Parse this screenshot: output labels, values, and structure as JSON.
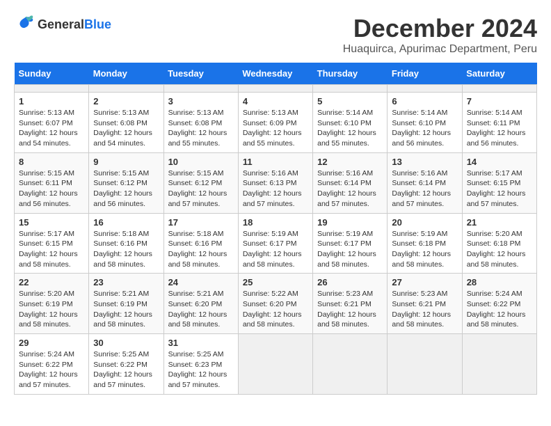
{
  "header": {
    "logo_general": "General",
    "logo_blue": "Blue",
    "title": "December 2024",
    "subtitle": "Huaquirca, Apurimac Department, Peru"
  },
  "calendar": {
    "days_of_week": [
      "Sunday",
      "Monday",
      "Tuesday",
      "Wednesday",
      "Thursday",
      "Friday",
      "Saturday"
    ],
    "weeks": [
      [
        {
          "day": "",
          "info": ""
        },
        {
          "day": "",
          "info": ""
        },
        {
          "day": "",
          "info": ""
        },
        {
          "day": "",
          "info": ""
        },
        {
          "day": "",
          "info": ""
        },
        {
          "day": "",
          "info": ""
        },
        {
          "day": "",
          "info": ""
        }
      ],
      [
        {
          "day": "1",
          "info": "Sunrise: 5:13 AM\nSunset: 6:07 PM\nDaylight: 12 hours\nand 54 minutes."
        },
        {
          "day": "2",
          "info": "Sunrise: 5:13 AM\nSunset: 6:08 PM\nDaylight: 12 hours\nand 54 minutes."
        },
        {
          "day": "3",
          "info": "Sunrise: 5:13 AM\nSunset: 6:08 PM\nDaylight: 12 hours\nand 55 minutes."
        },
        {
          "day": "4",
          "info": "Sunrise: 5:13 AM\nSunset: 6:09 PM\nDaylight: 12 hours\nand 55 minutes."
        },
        {
          "day": "5",
          "info": "Sunrise: 5:14 AM\nSunset: 6:10 PM\nDaylight: 12 hours\nand 55 minutes."
        },
        {
          "day": "6",
          "info": "Sunrise: 5:14 AM\nSunset: 6:10 PM\nDaylight: 12 hours\nand 56 minutes."
        },
        {
          "day": "7",
          "info": "Sunrise: 5:14 AM\nSunset: 6:11 PM\nDaylight: 12 hours\nand 56 minutes."
        }
      ],
      [
        {
          "day": "8",
          "info": "Sunrise: 5:15 AM\nSunset: 6:11 PM\nDaylight: 12 hours\nand 56 minutes."
        },
        {
          "day": "9",
          "info": "Sunrise: 5:15 AM\nSunset: 6:12 PM\nDaylight: 12 hours\nand 56 minutes."
        },
        {
          "day": "10",
          "info": "Sunrise: 5:15 AM\nSunset: 6:12 PM\nDaylight: 12 hours\nand 57 minutes."
        },
        {
          "day": "11",
          "info": "Sunrise: 5:16 AM\nSunset: 6:13 PM\nDaylight: 12 hours\nand 57 minutes."
        },
        {
          "day": "12",
          "info": "Sunrise: 5:16 AM\nSunset: 6:14 PM\nDaylight: 12 hours\nand 57 minutes."
        },
        {
          "day": "13",
          "info": "Sunrise: 5:16 AM\nSunset: 6:14 PM\nDaylight: 12 hours\nand 57 minutes."
        },
        {
          "day": "14",
          "info": "Sunrise: 5:17 AM\nSunset: 6:15 PM\nDaylight: 12 hours\nand 57 minutes."
        }
      ],
      [
        {
          "day": "15",
          "info": "Sunrise: 5:17 AM\nSunset: 6:15 PM\nDaylight: 12 hours\nand 58 minutes."
        },
        {
          "day": "16",
          "info": "Sunrise: 5:18 AM\nSunset: 6:16 PM\nDaylight: 12 hours\nand 58 minutes."
        },
        {
          "day": "17",
          "info": "Sunrise: 5:18 AM\nSunset: 6:16 PM\nDaylight: 12 hours\nand 58 minutes."
        },
        {
          "day": "18",
          "info": "Sunrise: 5:19 AM\nSunset: 6:17 PM\nDaylight: 12 hours\nand 58 minutes."
        },
        {
          "day": "19",
          "info": "Sunrise: 5:19 AM\nSunset: 6:17 PM\nDaylight: 12 hours\nand 58 minutes."
        },
        {
          "day": "20",
          "info": "Sunrise: 5:19 AM\nSunset: 6:18 PM\nDaylight: 12 hours\nand 58 minutes."
        },
        {
          "day": "21",
          "info": "Sunrise: 5:20 AM\nSunset: 6:18 PM\nDaylight: 12 hours\nand 58 minutes."
        }
      ],
      [
        {
          "day": "22",
          "info": "Sunrise: 5:20 AM\nSunset: 6:19 PM\nDaylight: 12 hours\nand 58 minutes."
        },
        {
          "day": "23",
          "info": "Sunrise: 5:21 AM\nSunset: 6:19 PM\nDaylight: 12 hours\nand 58 minutes."
        },
        {
          "day": "24",
          "info": "Sunrise: 5:21 AM\nSunset: 6:20 PM\nDaylight: 12 hours\nand 58 minutes."
        },
        {
          "day": "25",
          "info": "Sunrise: 5:22 AM\nSunset: 6:20 PM\nDaylight: 12 hours\nand 58 minutes."
        },
        {
          "day": "26",
          "info": "Sunrise: 5:23 AM\nSunset: 6:21 PM\nDaylight: 12 hours\nand 58 minutes."
        },
        {
          "day": "27",
          "info": "Sunrise: 5:23 AM\nSunset: 6:21 PM\nDaylight: 12 hours\nand 58 minutes."
        },
        {
          "day": "28",
          "info": "Sunrise: 5:24 AM\nSunset: 6:22 PM\nDaylight: 12 hours\nand 58 minutes."
        }
      ],
      [
        {
          "day": "29",
          "info": "Sunrise: 5:24 AM\nSunset: 6:22 PM\nDaylight: 12 hours\nand 57 minutes."
        },
        {
          "day": "30",
          "info": "Sunrise: 5:25 AM\nSunset: 6:22 PM\nDaylight: 12 hours\nand 57 minutes."
        },
        {
          "day": "31",
          "info": "Sunrise: 5:25 AM\nSunset: 6:23 PM\nDaylight: 12 hours\nand 57 minutes."
        },
        {
          "day": "",
          "info": ""
        },
        {
          "day": "",
          "info": ""
        },
        {
          "day": "",
          "info": ""
        },
        {
          "day": "",
          "info": ""
        }
      ]
    ]
  }
}
